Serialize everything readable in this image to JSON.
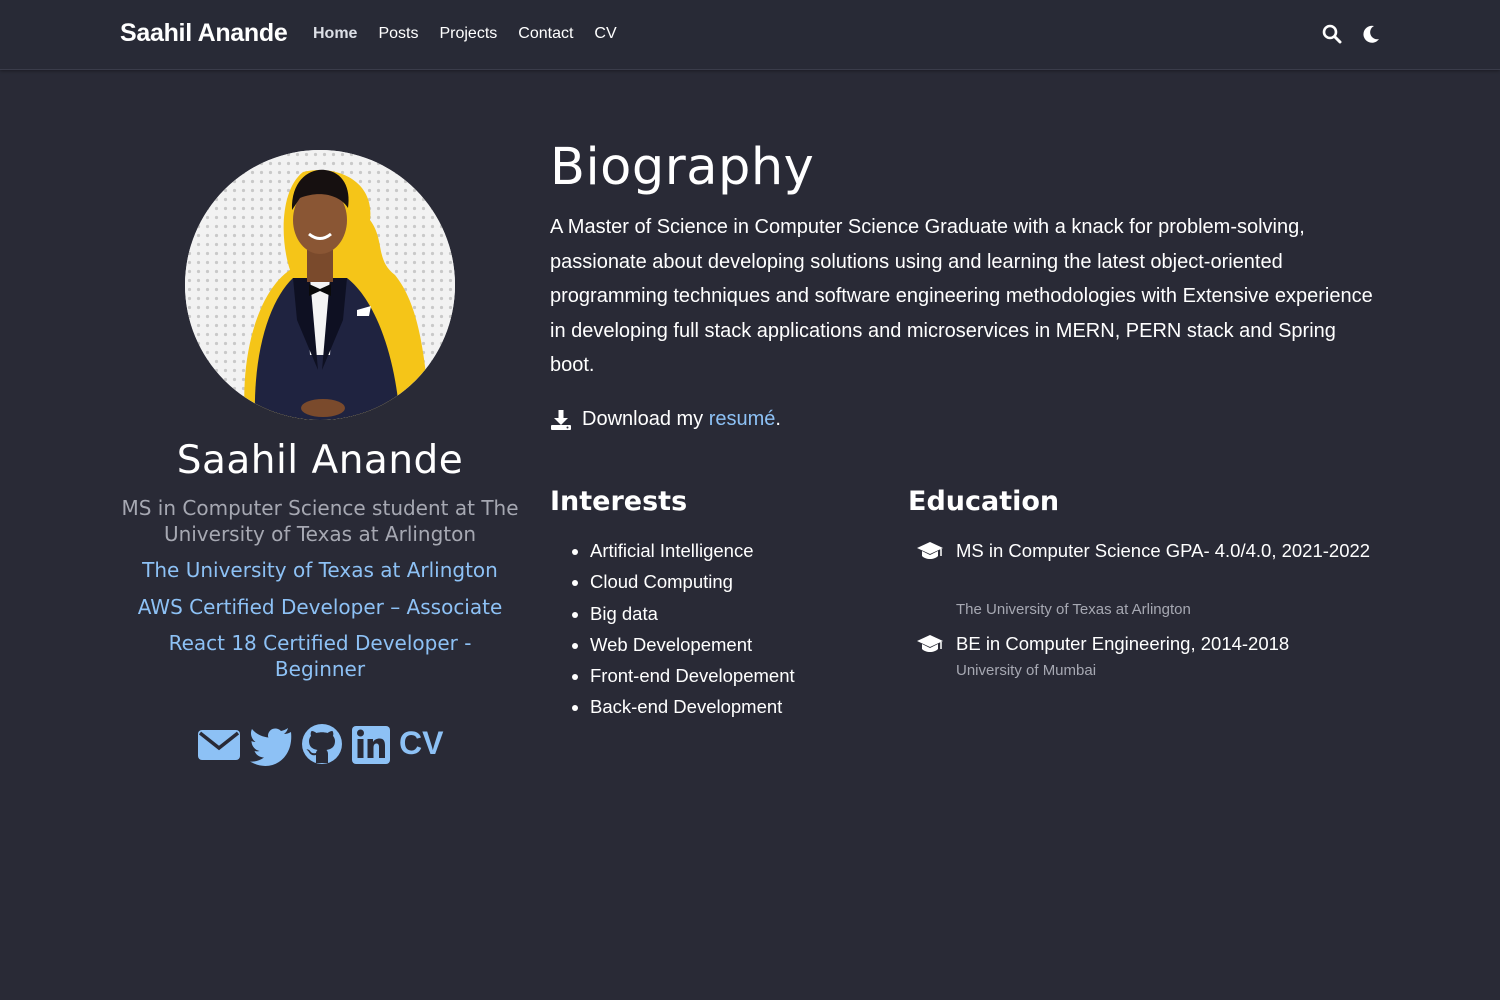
{
  "nav": {
    "brand": "Saahil Anande",
    "links": [
      "Home",
      "Posts",
      "Projects",
      "Contact",
      "CV"
    ],
    "active": "Home",
    "icons": [
      "search-icon",
      "moon-icon"
    ]
  },
  "profile": {
    "name": "Saahil Anande",
    "role": "MS in Computer Science student at The University of Texas at Arlington",
    "links": [
      "The University of Texas at Arlington",
      "AWS Certified Developer – Associate",
      "React 18 Certified Developer - Beginner"
    ],
    "social_icons": [
      "email-icon",
      "twitter-icon",
      "github-icon",
      "linkedin-icon",
      "cv-icon"
    ],
    "cv_label": "CV"
  },
  "biography": {
    "title": "Biography",
    "text": "A Master of Science in Computer Science Graduate with a knack for problem-solving, passionate about developing solutions using and learning the latest object-oriented programming techniques and software engineering methodologies with Extensive experience in developing full stack applications and microservices in MERN, PERN stack and Spring boot.",
    "download_prefix": "Download my ",
    "download_link": "resumé",
    "download_suffix": "."
  },
  "interests": {
    "title": "Interests",
    "items": [
      "Artificial Intelligence",
      "Cloud Computing",
      "Big data",
      "Web Developement",
      "Front-end Developement",
      "Back-end Development"
    ]
  },
  "education": {
    "title": "Education",
    "items": [
      {
        "course": "MS in Computer Science GPA- 4.0/4.0, 2021-2022",
        "institution": "The University of Texas at Arlington"
      },
      {
        "course": "BE in Computer Engineering, 2014-2018",
        "institution": "University of Mumbai"
      }
    ]
  },
  "colors": {
    "background": "#292a36",
    "link": "#8dc1f5",
    "muted": "#a6a8b2"
  }
}
